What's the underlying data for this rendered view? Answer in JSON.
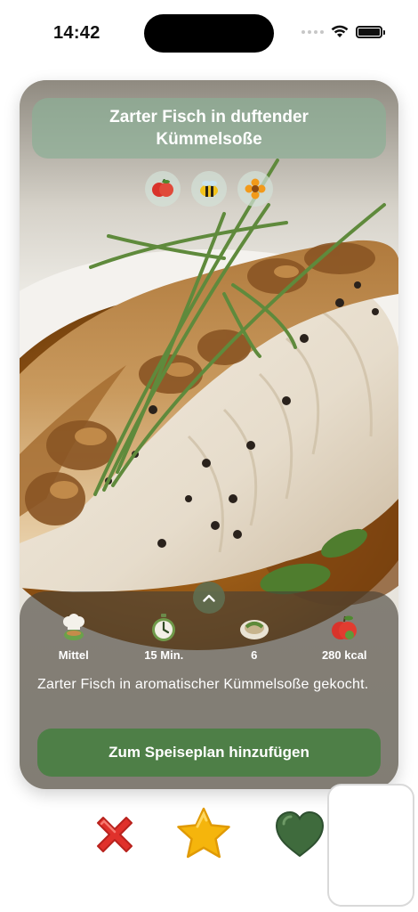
{
  "status_bar": {
    "time": "14:42"
  },
  "recipe": {
    "title": "Zarter Fisch in duftender Kümmelsoße",
    "tags": [
      "apple-tomato-icon",
      "bee-icon",
      "flower-icon"
    ],
    "stats": [
      {
        "icon": "chef-hat-icon",
        "label": "Mittel"
      },
      {
        "icon": "timer-icon",
        "label": "15 Min."
      },
      {
        "icon": "plate-icon",
        "label": "6"
      },
      {
        "icon": "apple-icon",
        "label": "280 kcal"
      }
    ],
    "description": "Zarter Fisch in aromatischer Kümmelsoße gekocht.",
    "add_button": "Zum Speiseplan hinzufügen"
  },
  "actions": {
    "dislike": "x-icon",
    "favorite": "star-icon",
    "like": "heart-icon"
  },
  "colors": {
    "accent": "#4e7f47",
    "title_box": "#8caf96",
    "dislike": "#e0312b",
    "favorite": "#f5b50c",
    "like": "#3f6b3d"
  }
}
